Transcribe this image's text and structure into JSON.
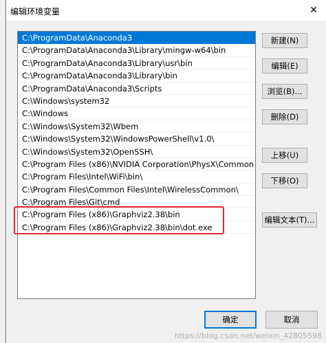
{
  "window": {
    "title": "编辑环境变量",
    "close_glyph": "✕"
  },
  "paths": [
    "C:\\ProgramData\\Anaconda3",
    "C:\\ProgramData\\Anaconda3\\Library\\mingw-w64\\bin",
    "C:\\ProgramData\\Anaconda3\\Library\\usr\\bin",
    "C:\\ProgramData\\Anaconda3\\Library\\bin",
    "C:\\ProgramData\\Anaconda3\\Scripts",
    "C:\\Windows\\system32",
    "C:\\Windows",
    "C:\\Windows\\System32\\Wbem",
    "C:\\Windows\\System32\\WindowsPowerShell\\v1.0\\",
    "C:\\Windows\\System32\\OpenSSH\\",
    "C:\\Program Files (x86)\\NVIDIA Corporation\\PhysX\\Common",
    "C:\\Program Files\\Intel\\WiFi\\bin\\",
    "C:\\Program Files\\Common Files\\Intel\\WirelessCommon\\",
    "C:\\Program Files\\Git\\cmd",
    "C:\\Program Files (x86)\\Graphviz2.38\\bin",
    "C:\\Program Files (x86)\\Graphviz2.38\\bin\\dot.exe"
  ],
  "selected_index": 0,
  "buttons": {
    "new": "新建(N)",
    "edit": "编辑(E)",
    "browse": "浏览(B)...",
    "delete": "删除(D)",
    "move_up": "上移(U)",
    "move_down": "下移(O)",
    "edit_text": "编辑文本(T)...",
    "ok": "确定",
    "cancel": "取消"
  },
  "watermark": "https://blog.csdn.net/weixin_42805598",
  "colors": {
    "selection": "#0078d7",
    "highlight_box": "#e0262a"
  }
}
